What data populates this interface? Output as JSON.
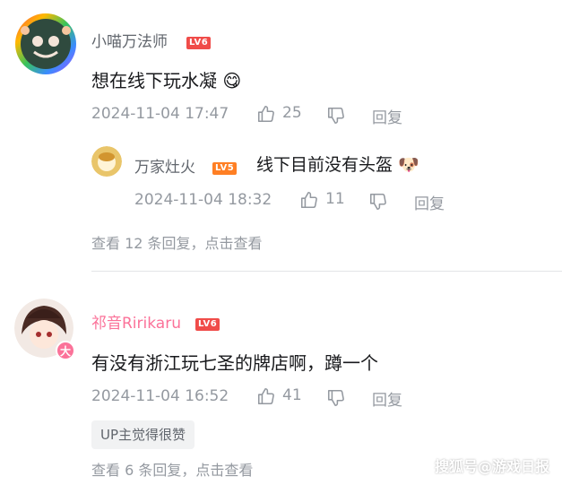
{
  "comments": [
    {
      "username": "小喵万法师",
      "level": "LV6",
      "text": "想在线下玩水凝",
      "emoji": "😋",
      "time": "2024-11-04 17:47",
      "likes": "25",
      "reply_label": "回复",
      "sub_reply": {
        "username": "万家灶火",
        "level": "LV5",
        "text": "线下目前没有头盔",
        "emoji": "🐶",
        "time": "2024-11-04 18:32",
        "likes": "11",
        "reply_label": "回复"
      },
      "view_more": "查看 12 条回复，点击查看"
    },
    {
      "username": "祁音Ririkaru",
      "level": "LV6",
      "avatar_badge": "大",
      "text": "有没有浙江玩七圣的牌店啊，蹲一个",
      "time": "2024-11-04 16:52",
      "likes": "41",
      "reply_label": "回复",
      "up_tag": "UP主觉得很赞",
      "view_more": "查看 6 条回复，点击查看"
    }
  ],
  "watermark": "搜狐号@游戏日报",
  "colors": {
    "accent_pink": "#fb7299",
    "muted_text": "#9499a0",
    "level_badge": "#f04c49"
  }
}
